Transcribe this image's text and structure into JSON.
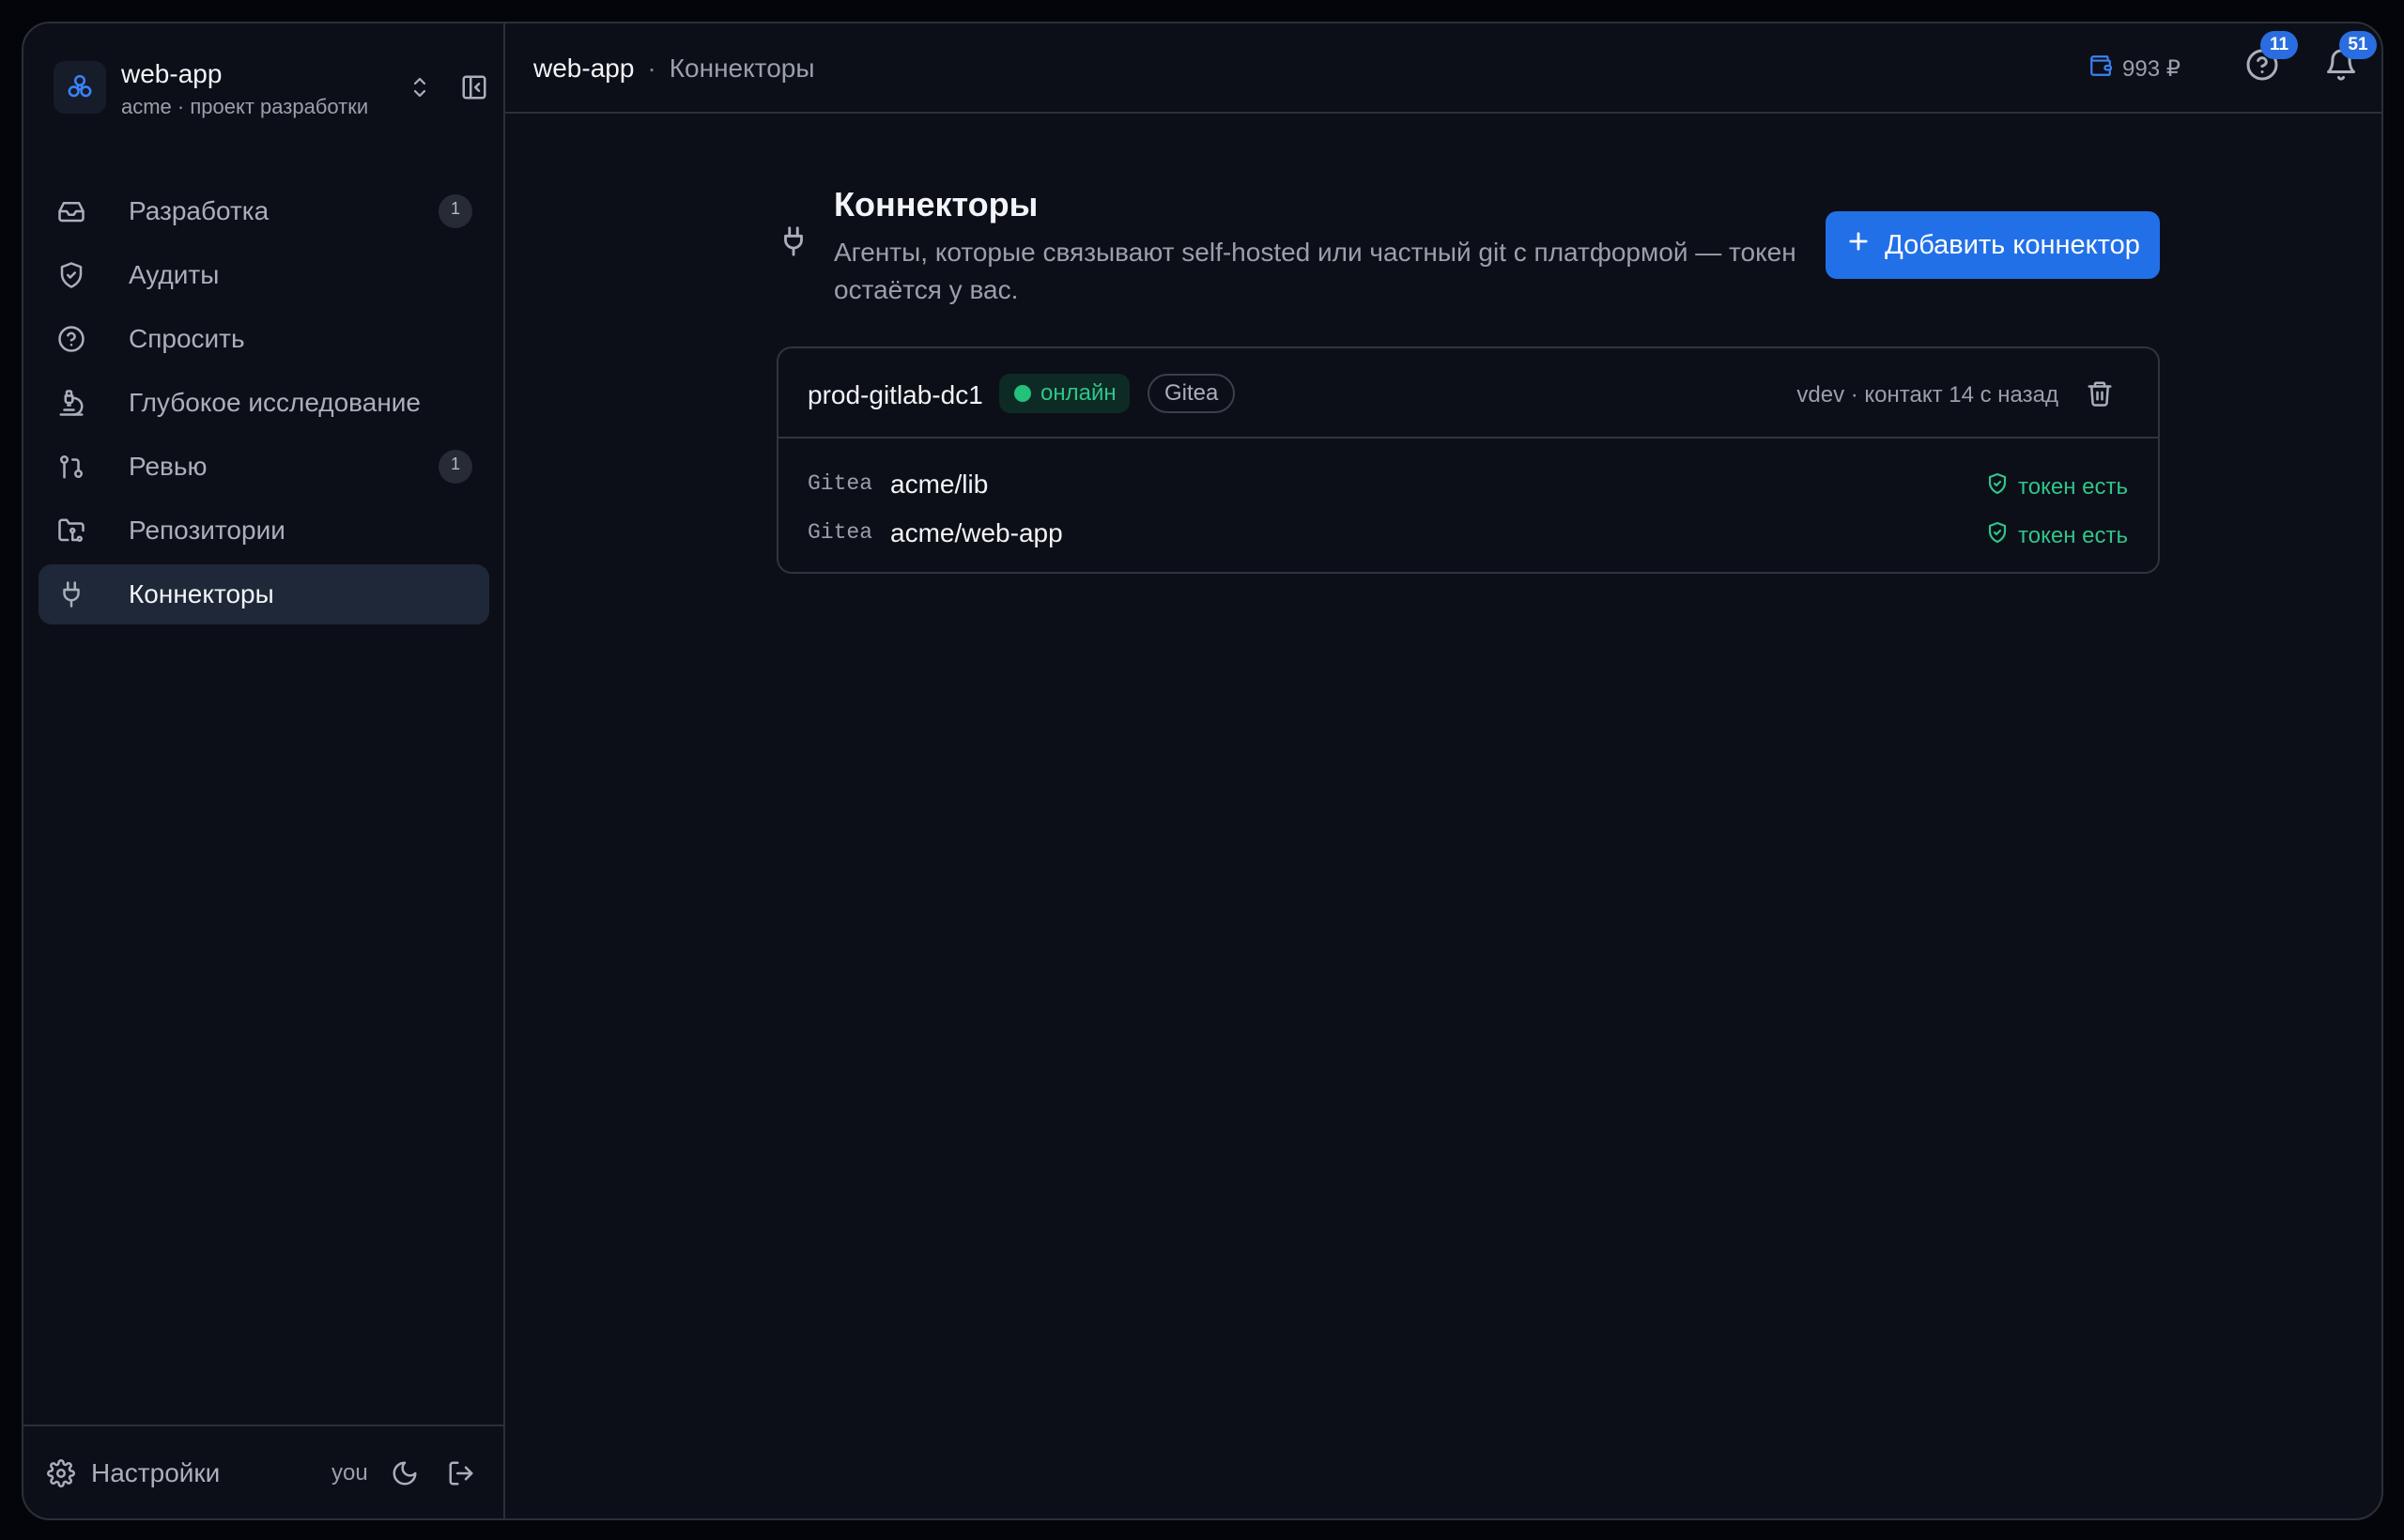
{
  "project": {
    "name": "web-app",
    "subtitle": "acme · проект разработки"
  },
  "sidebar": {
    "items": [
      {
        "label": "Разработка",
        "icon": "inbox-icon",
        "badge": "1",
        "active": false
      },
      {
        "label": "Аудиты",
        "icon": "shield-check-icon",
        "badge": null,
        "active": false
      },
      {
        "label": "Спросить",
        "icon": "help-circle-icon",
        "badge": null,
        "active": false
      },
      {
        "label": "Глубокое исследование",
        "icon": "microscope-icon",
        "badge": null,
        "active": false
      },
      {
        "label": "Ревью",
        "icon": "git-pull-request-icon",
        "badge": "1",
        "active": false
      },
      {
        "label": "Репозитории",
        "icon": "folder-git-icon",
        "badge": null,
        "active": false
      },
      {
        "label": "Коннекторы",
        "icon": "plug-icon",
        "badge": null,
        "active": true
      }
    ],
    "footer": {
      "settings_label": "Настройки",
      "user": "you"
    }
  },
  "topbar": {
    "breadcrumb": [
      "web-app",
      "Коннекторы"
    ],
    "separator": "·",
    "balance": "993 ₽",
    "help_count": "11",
    "notifications_count": "51"
  },
  "main": {
    "title": "Коннекторы",
    "description": "Агенты, которые связывают self-hosted или частный git с платформой — токен остаётся у вас.",
    "add_button_label": "Добавить коннектор"
  },
  "connector": {
    "name": "prod-gitlab-dc1",
    "status": "онлайн",
    "provider": "Gitea",
    "meta": "vdev · контакт 14 с назад",
    "repos": [
      {
        "provider": "Gitea",
        "name": "acme/lib",
        "token_status": "токен есть"
      },
      {
        "provider": "Gitea",
        "name": "acme/web-app",
        "token_status": "токен есть"
      }
    ]
  },
  "colors": {
    "accent": "#2270e8",
    "success": "#2fc58b",
    "background": "#0c0f17"
  }
}
